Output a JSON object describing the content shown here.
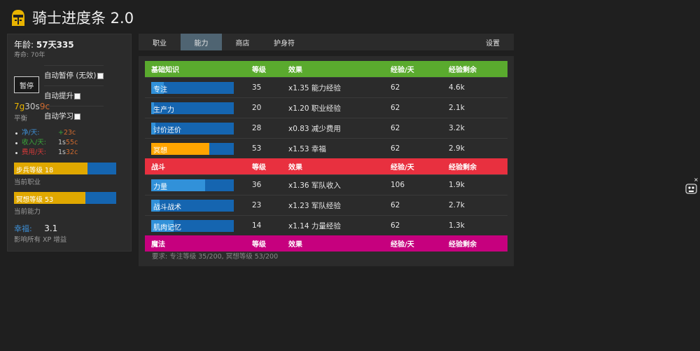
{
  "app": {
    "title": "骑士进度条 2.0"
  },
  "sidebar": {
    "age_label": "年龄:",
    "age_value": "57天335",
    "lifespan": "寿命:  70年",
    "pause_label": "暂停",
    "checkboxes": [
      "自动暂停 (无效)",
      "自动提升",
      "自动学习"
    ],
    "coins": {
      "gold": "7",
      "gold_unit": "g",
      "silver": "30",
      "silver_unit": "s",
      "copper": "9",
      "copper_unit": "c"
    },
    "balance_label": "平衡",
    "finances": [
      {
        "label": "净/天:",
        "value_prefix": "+",
        "value": "23c",
        "color": "#3d8fd6"
      },
      {
        "label": "收入/天:",
        "value_prefix": "1s",
        "value": "55c",
        "color": "#3aa53a"
      },
      {
        "label": "费用/天:",
        "value_prefix": "1s",
        "value": "32c",
        "color": "#d83a3a"
      }
    ],
    "job_bar": {
      "label": "步兵等级 18",
      "progress": 0.72,
      "caption": "当前职业"
    },
    "skill_bar": {
      "label": "冥想等级 53",
      "progress": 0.7,
      "caption": "当前能力"
    },
    "happiness_label": "幸福:",
    "happiness_value": "3.1",
    "happiness_caption": "影响所有 XP 增益"
  },
  "tabs": [
    {
      "label": "职业",
      "active": false
    },
    {
      "label": "能力",
      "active": true
    },
    {
      "label": "商店",
      "active": false
    },
    {
      "label": "护身符",
      "active": false
    }
  ],
  "settings_tab": "设置",
  "table": {
    "columns": [
      "等级",
      "效果",
      "经验/天",
      "经验剩余"
    ],
    "colors": {
      "fundamentals": "#5aaa2e",
      "combat": "#e8303f",
      "magic": "#c6007e",
      "fill": "#3191d9",
      "fill_active": "#ffa500",
      "bar_bg": "#1565b0"
    },
    "groups": [
      {
        "name": "基础知识",
        "skills": [
          {
            "name": "专注",
            "level": "35",
            "effect": "x1.35 能力经验",
            "xp_day": "62",
            "xp_left": "4.6k",
            "progress": 0.15,
            "active": false
          },
          {
            "name": "生产力",
            "level": "20",
            "effect": "x1.20 职业经验",
            "xp_day": "62",
            "xp_left": "2.1k",
            "progress": 0.03,
            "active": false
          },
          {
            "name": "讨价还价",
            "level": "28",
            "effect": "x0.83 减少费用",
            "xp_day": "62",
            "xp_left": "3.2k",
            "progress": 0.05,
            "active": false
          },
          {
            "name": "冥想",
            "level": "53",
            "effect": "x1.53 幸福",
            "xp_day": "62",
            "xp_left": "2.9k",
            "progress": 0.7,
            "active": true
          }
        ]
      },
      {
        "name": "战斗",
        "skills": [
          {
            "name": "力量",
            "level": "36",
            "effect": "x1.36 军队收入",
            "xp_day": "106",
            "xp_left": "1.9k",
            "progress": 0.65,
            "active": false
          },
          {
            "name": "战斗战术",
            "level": "23",
            "effect": "x1.23 军队经验",
            "xp_day": "62",
            "xp_left": "2.7k",
            "progress": 0.1,
            "active": false
          },
          {
            "name": "肌肉记忆",
            "level": "14",
            "effect": "x1.14 力量经验",
            "xp_day": "62",
            "xp_left": "1.3k",
            "progress": 0.27,
            "active": false
          }
        ]
      },
      {
        "name": "魔法",
        "skills": []
      }
    ],
    "requirement": "要求: 专注等级 35/200, 冥想等级 53/200"
  }
}
